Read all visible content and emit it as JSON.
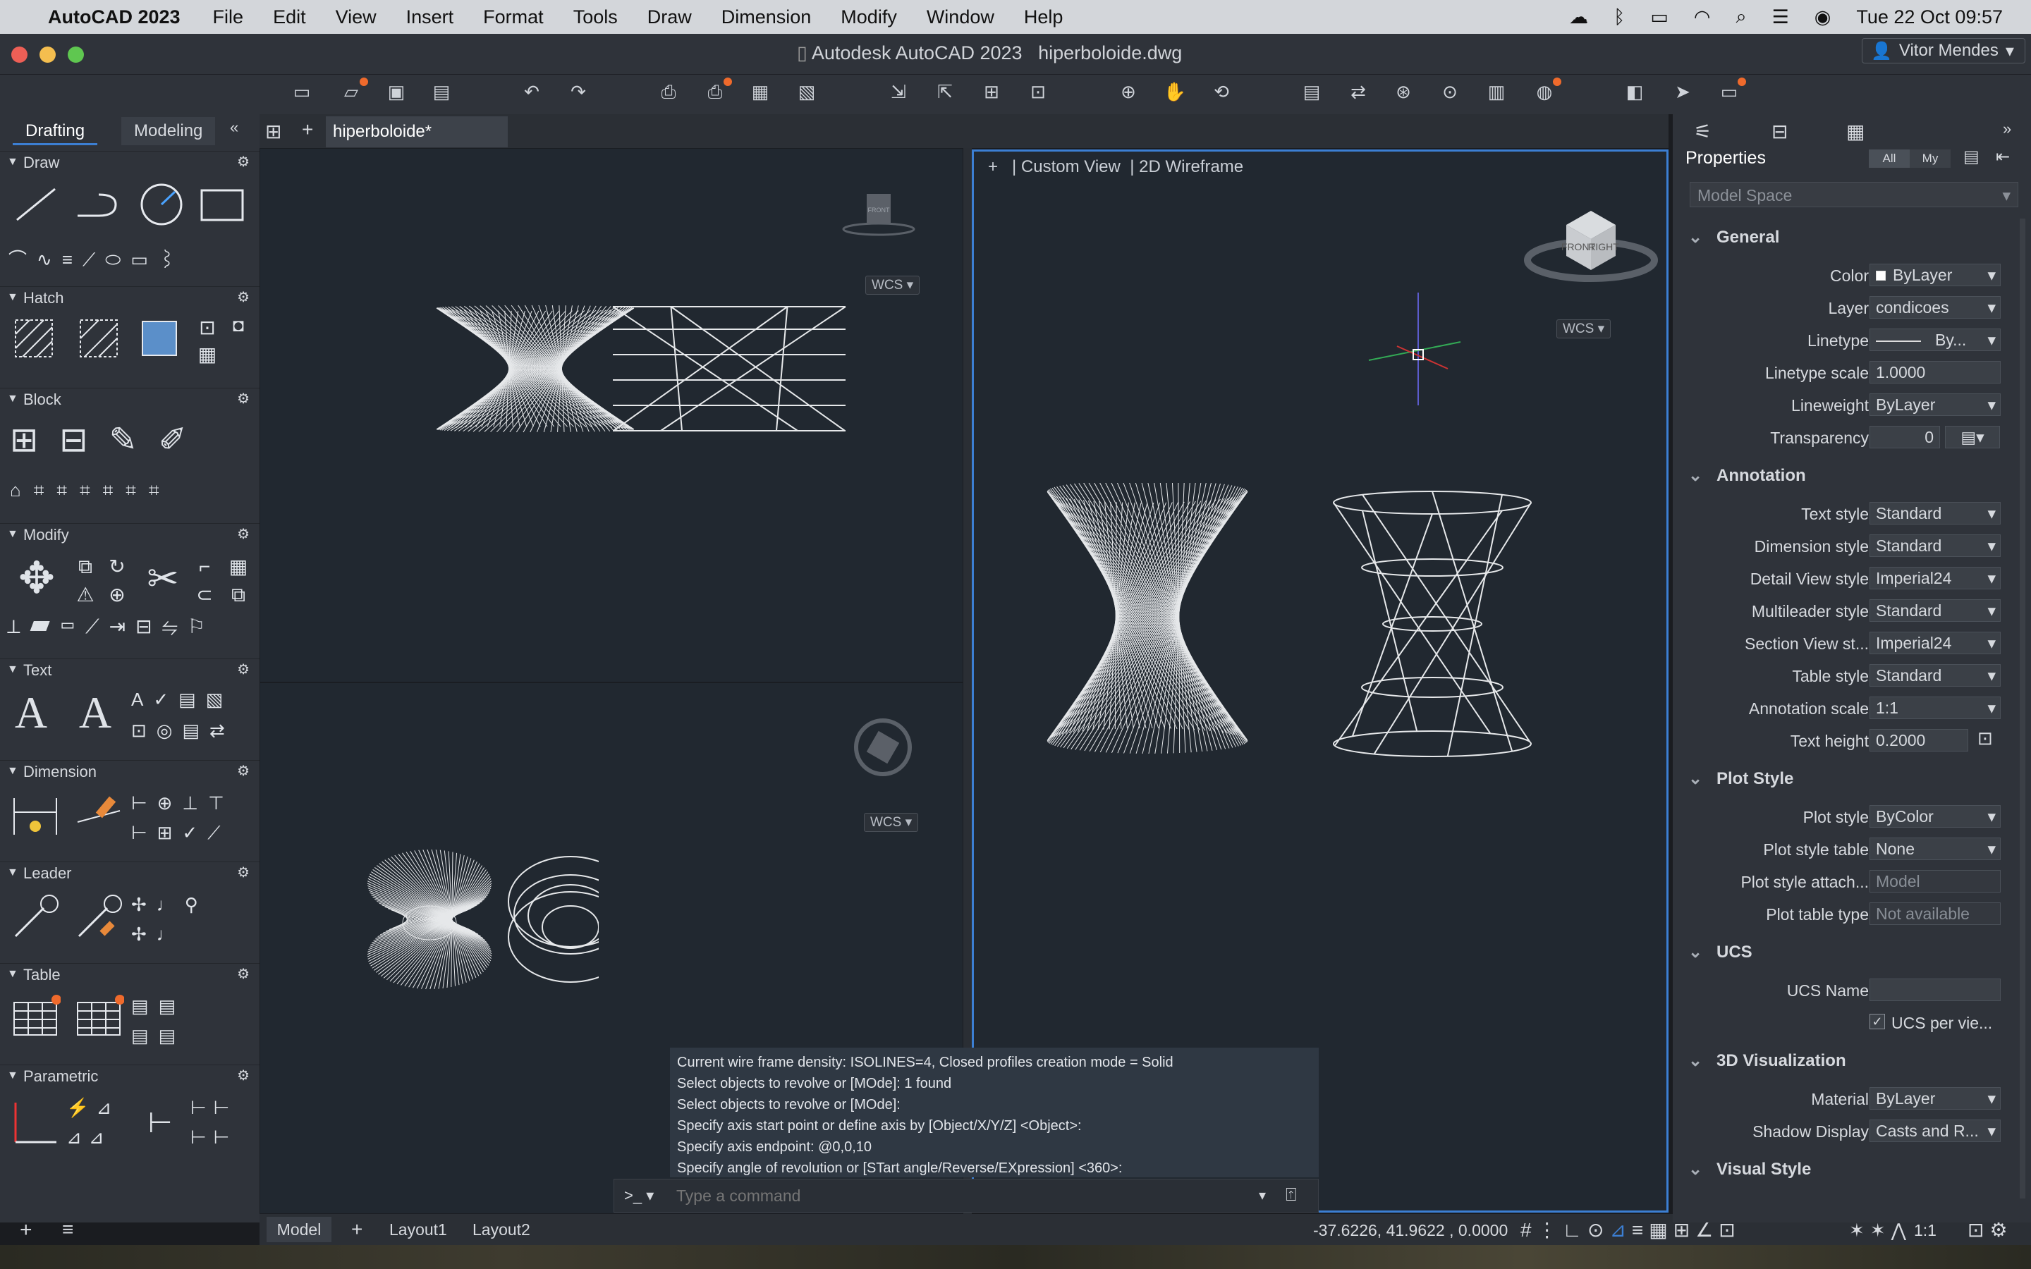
{
  "menubar": {
    "app": "AutoCAD 2023",
    "items": [
      "File",
      "Edit",
      "View",
      "Insert",
      "Format",
      "Tools",
      "Draw",
      "Dimension",
      "Modify",
      "Window",
      "Help"
    ],
    "clock": "Tue 22 Oct  09:57"
  },
  "window": {
    "title": "Autodesk AutoCAD 2023",
    "file": "hiperboloide.dwg",
    "user": "Vitor Mendes"
  },
  "palette": {
    "tabs": [
      "Drafting",
      "Modeling"
    ],
    "sections": [
      "Draw",
      "Hatch",
      "Block",
      "Modify",
      "Text",
      "Dimension",
      "Leader",
      "Table",
      "Parametric"
    ]
  },
  "document": {
    "tab": "hiperboloide*"
  },
  "viewport": {
    "view": "Custom View",
    "style": "2D Wireframe",
    "ucs": "WCS",
    "cube_front": "FRONT",
    "cube_right": "RIGHT"
  },
  "command": {
    "history": [
      "Current wire frame density:  ISOLINES=4, Closed profiles creation mode = Solid",
      "Select objects to revolve or [MOde]: 1 found",
      "Select objects to revolve or [MOde]:",
      "Specify axis start point or define axis by [Object/X/Y/Z] <Object>:",
      "Specify axis endpoint: @0,0,10",
      "Specify angle of revolution or [STart angle/Reverse/EXpression] <360>:"
    ],
    "placeholder": "Type a command"
  },
  "statusbar": {
    "tabs": [
      "Model",
      "Layout1",
      "Layout2"
    ],
    "coords": "-37.6226, 41.9622 , 0.0000",
    "scale": "1:1"
  },
  "properties": {
    "title": "Properties",
    "filter_all": "All",
    "filter_my": "My",
    "selection": "Model Space",
    "general": {
      "title": "General",
      "rows": [
        [
          "Color",
          "ByLayer"
        ],
        [
          "Layer",
          "condicoes"
        ],
        [
          "Linetype",
          "By..."
        ],
        [
          "Linetype scale",
          "1.0000"
        ],
        [
          "Lineweight",
          "ByLayer"
        ],
        [
          "Transparency",
          "0"
        ]
      ]
    },
    "annotation": {
      "title": "Annotation",
      "rows": [
        [
          "Text style",
          "Standard"
        ],
        [
          "Dimension style",
          "Standard"
        ],
        [
          "Detail View style",
          "Imperial24"
        ],
        [
          "Multileader style",
          "Standard"
        ],
        [
          "Section View st...",
          "Imperial24"
        ],
        [
          "Table style",
          "Standard"
        ],
        [
          "Annotation scale",
          "1:1"
        ],
        [
          "Text height",
          "0.2000"
        ]
      ]
    },
    "plot": {
      "title": "Plot Style",
      "rows": [
        [
          "Plot style",
          "ByColor"
        ],
        [
          "Plot style table",
          "None"
        ],
        [
          "Plot style attach...",
          "Model"
        ],
        [
          "Plot table type",
          "Not available"
        ]
      ]
    },
    "ucs": {
      "title": "UCS",
      "rows": [
        [
          "UCS Name",
          ""
        ]
      ],
      "per_viewport": "UCS per vie..."
    },
    "viz": {
      "title": "3D Visualization",
      "rows": [
        [
          "Material",
          "ByLayer"
        ],
        [
          "Shadow Display",
          "Casts and R..."
        ]
      ]
    },
    "visual_style": {
      "title": "Visual Style"
    }
  }
}
